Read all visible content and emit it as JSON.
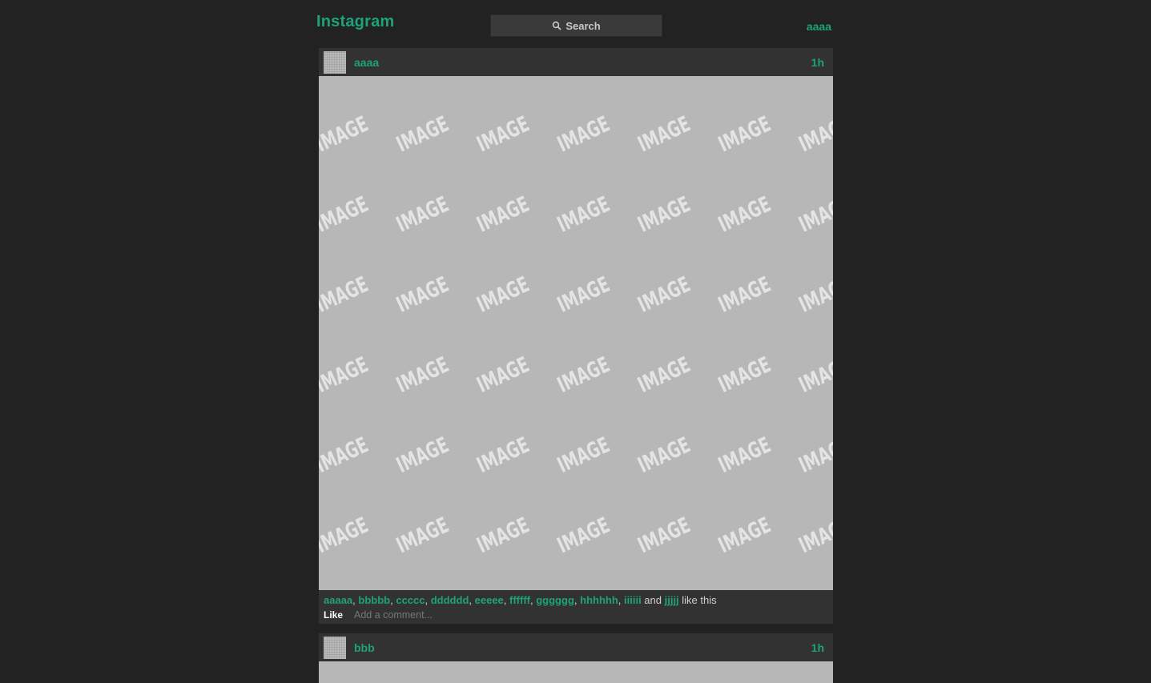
{
  "header": {
    "brand": "Instagram",
    "search_label": "Search",
    "username": "aaaa"
  },
  "posts": [
    {
      "username": "aaaa",
      "time": "1h",
      "image_watermark": "IMAGE",
      "likers": [
        "aaaaa",
        "bbbbb",
        "ccccc",
        "dddddd",
        "eeeee",
        "ffffff",
        "gggggg",
        "hhhhhh",
        "iiiiii",
        "jjjjj"
      ],
      "and_word": "and",
      "like_suffix": "like this",
      "like_label": "Like",
      "comment_placeholder": "Add a comment..."
    },
    {
      "username": "bbb",
      "time": "1h"
    }
  ],
  "colors": {
    "background": "#222222",
    "accent": "#1fa27a",
    "panel": "#323232",
    "image_placeholder": "#b7b7b7"
  }
}
